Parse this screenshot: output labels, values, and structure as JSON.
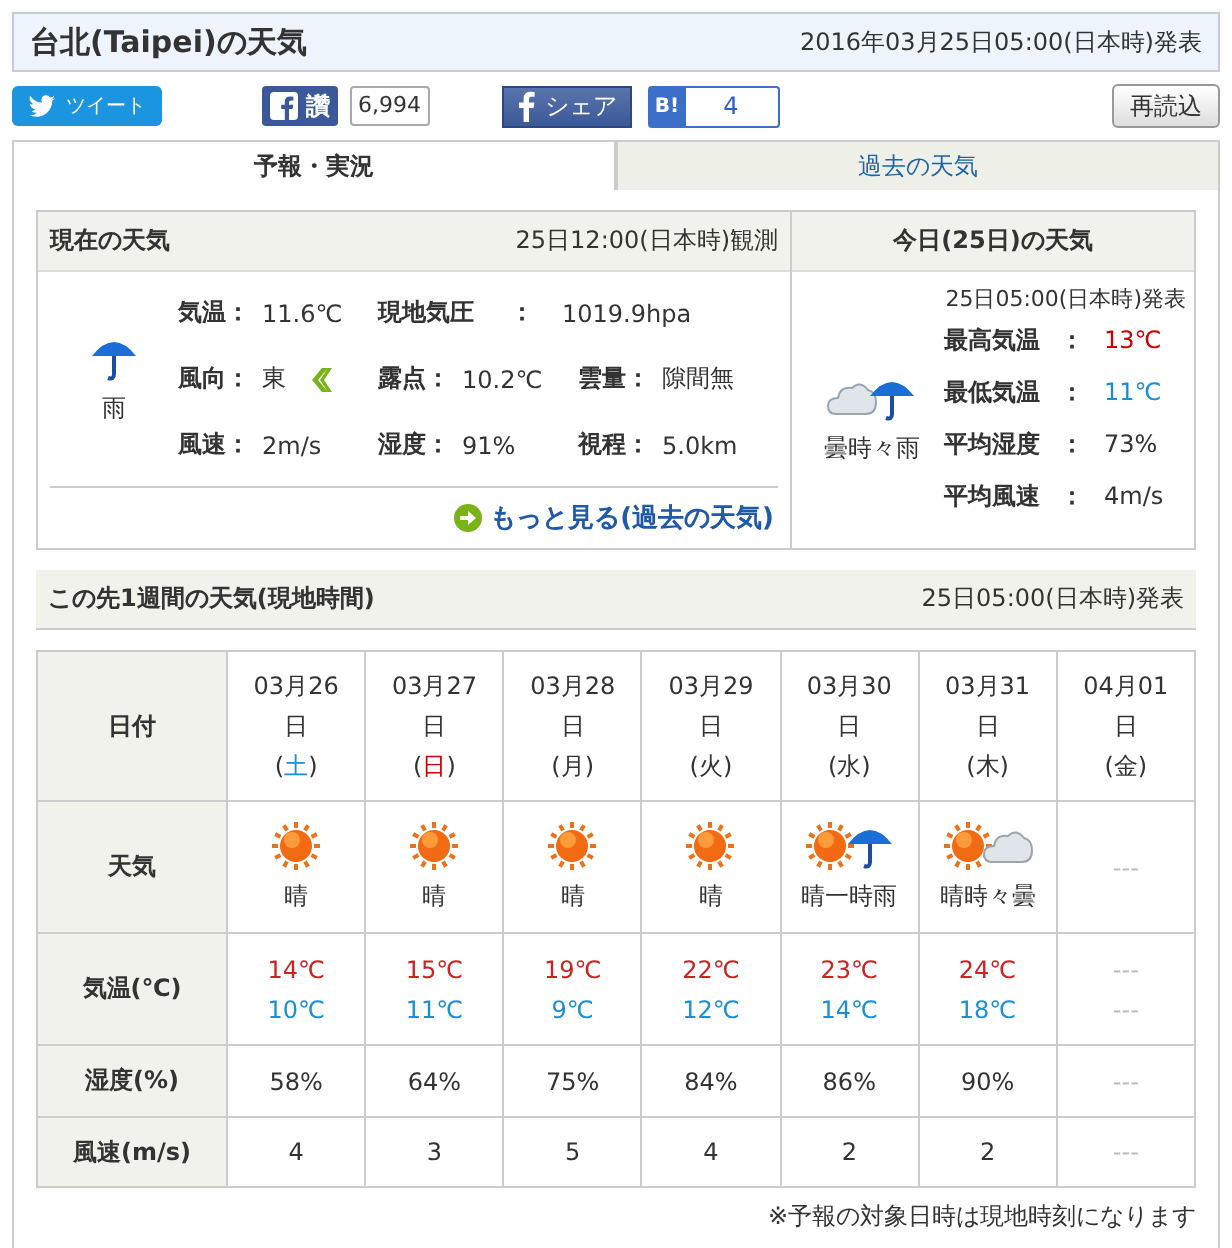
{
  "header": {
    "title": "台北(Taipei)の天気",
    "issued": "2016年03月25日05:00(日本時)発表"
  },
  "social": {
    "tweet": "ツイート",
    "like": "讚",
    "like_count": "6,994",
    "share": "シェア",
    "hatena_logo": "B!",
    "hatena_count": "4",
    "reload": "再読込"
  },
  "tabs": [
    {
      "label": "予報・実況",
      "selected": true
    },
    {
      "label": "過去の天気",
      "selected": false
    }
  ],
  "current": {
    "title": "現在の天気",
    "observed": "25日12:00(日本時)観測",
    "icons": [
      {
        "kind": "rain"
      }
    ],
    "weather": "雨",
    "rows": [
      [
        {
          "label": "気温",
          "sep": "：",
          "value": "11.6℃"
        },
        {
          "label": "現地気圧",
          "sep": "：",
          "value": "1019.9hpa",
          "kind": "wide"
        }
      ],
      [
        {
          "label": "風向",
          "sep": "：",
          "value": "東",
          "kind": "direction"
        },
        {
          "label": "露点",
          "sep": "：",
          "value": "10.2℃"
        },
        {
          "label": "雲量",
          "sep": "：",
          "value": "隙間無"
        }
      ],
      [
        {
          "label": "風速",
          "sep": "：",
          "value": "2m/s"
        },
        {
          "label": "湿度",
          "sep": "：",
          "value": "91%"
        },
        {
          "label": "視程",
          "sep": "：",
          "value": "5.0km"
        }
      ]
    ],
    "more_link": "もっと見る(過去の天気)"
  },
  "today": {
    "title": "今日(25日)の天気",
    "issued": "25日05:00(日本時)発表",
    "icons": [
      {
        "kind": "cloud"
      },
      {
        "kind": "rain"
      }
    ],
    "weather": "曇時々雨",
    "stats": [
      {
        "label": "最高気温",
        "sep": "：",
        "value": "13℃",
        "color": "#cc0000"
      },
      {
        "label": "最低気温",
        "sep": "：",
        "value": "11℃",
        "color": "#1a8fd6"
      },
      {
        "label": "平均湿度",
        "sep": "：",
        "value": "73%",
        "color": "#333333"
      },
      {
        "label": "平均風速",
        "sep": "：",
        "value": "4m/s",
        "color": "#333333"
      }
    ]
  },
  "week": {
    "title": "この先1週間の天気(現地時間)",
    "issued": "25日05:00(日本時)発表",
    "row_labels": [
      "日付",
      "天気",
      "気温(℃)",
      "湿度(%)",
      "風速(m/s)"
    ],
    "days": [
      {
        "date": "03月26",
        "date_suffix": "日",
        "open": "(",
        "weekday": "土",
        "close": ")",
        "color": "#1a8fd6",
        "available": true,
        "icons": [
          {
            "kind": "sun"
          }
        ],
        "weather": "晴",
        "high": "14℃",
        "low": "10℃",
        "humidity": "58%",
        "wind": "4"
      },
      {
        "date": "03月27",
        "date_suffix": "日",
        "open": "(",
        "weekday": "日",
        "close": ")",
        "color": "#cc0000",
        "available": true,
        "icons": [
          {
            "kind": "sun"
          }
        ],
        "weather": "晴",
        "high": "15℃",
        "low": "11℃",
        "humidity": "64%",
        "wind": "3"
      },
      {
        "date": "03月28",
        "date_suffix": "日",
        "open": "(",
        "weekday": "月",
        "close": ")",
        "color": "#333333",
        "available": true,
        "icons": [
          {
            "kind": "sun"
          }
        ],
        "weather": "晴",
        "high": "19℃",
        "low": "9℃",
        "humidity": "75%",
        "wind": "5"
      },
      {
        "date": "03月29",
        "date_suffix": "日",
        "open": "(",
        "weekday": "火",
        "close": ")",
        "color": "#333333",
        "available": true,
        "icons": [
          {
            "kind": "sun"
          }
        ],
        "weather": "晴",
        "high": "22℃",
        "low": "12℃",
        "humidity": "84%",
        "wind": "4"
      },
      {
        "date": "03月30",
        "date_suffix": "日",
        "open": "(",
        "weekday": "水",
        "close": ")",
        "color": "#333333",
        "available": true,
        "icons": [
          {
            "kind": "sun"
          },
          {
            "kind": "rain"
          }
        ],
        "weather": "晴一時雨",
        "high": "23℃",
        "low": "14℃",
        "humidity": "86%",
        "wind": "2"
      },
      {
        "date": "03月31",
        "date_suffix": "日",
        "open": "(",
        "weekday": "木",
        "close": ")",
        "color": "#333333",
        "available": true,
        "icons": [
          {
            "kind": "sun"
          },
          {
            "kind": "cloud"
          }
        ],
        "weather": "晴時々曇",
        "high": "24℃",
        "low": "18℃",
        "humidity": "90%",
        "wind": "2"
      },
      {
        "date": "04月01",
        "date_suffix": "日",
        "open": "(",
        "weekday": "金",
        "close": ")",
        "color": "#333333",
        "available": false,
        "weather": "---",
        "high": "---",
        "low": "---",
        "humidity": "---",
        "wind": "---"
      }
    ],
    "footnote": "※予報の対象日時は現地時刻になります"
  }
}
